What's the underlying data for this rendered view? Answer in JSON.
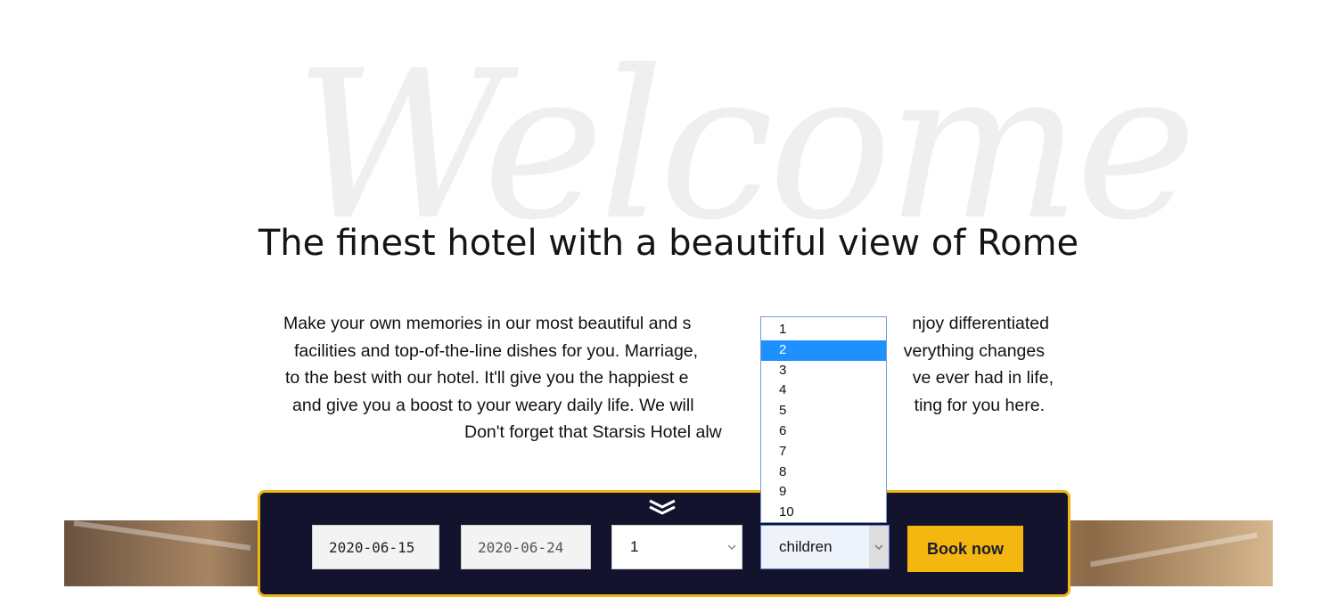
{
  "watermark": "Welcome",
  "heading": "The finest hotel with a beautiful view of Rome",
  "intro_lines": [
    "Make your own memories in our most beautiful and s",
    "facilities and top-of-the-line dishes for you. Marriage,",
    "to the best with our hotel. It'll give you the happiest e",
    "and give you a boost to your weary daily life. We will",
    "Don't forget that Starsis Hotel alw",
    "njoy differentiated",
    "verything changes",
    "ve ever had in life,",
    "ting for you here."
  ],
  "booking": {
    "checkin": "2020-06-15",
    "checkout": "2020-06-24",
    "adults_value": "1",
    "children_value": "children",
    "book_label": "Book now"
  },
  "children_options": [
    "1",
    "2",
    "3",
    "4",
    "5",
    "6",
    "7",
    "8",
    "9",
    "10"
  ],
  "selected_option": "2",
  "colors": {
    "bar_bg": "#14132d",
    "bar_border": "#f1b512",
    "button_bg": "#f4b710",
    "option_highlight": "#1e90ff"
  }
}
